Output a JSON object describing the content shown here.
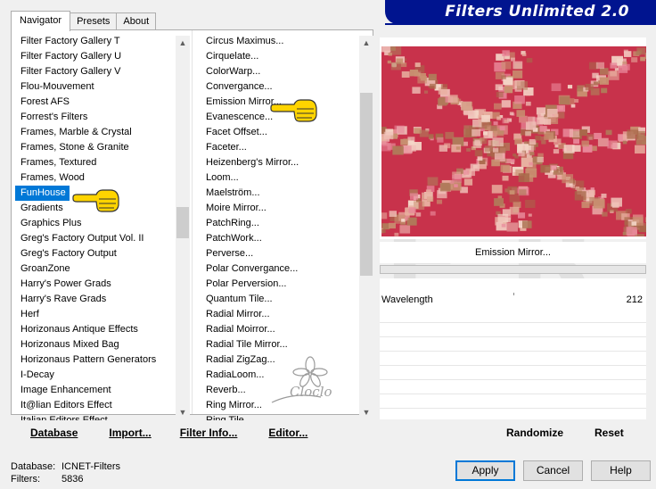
{
  "window": {
    "banner_title": "Filters Unlimited 2.0"
  },
  "tabs": [
    {
      "label": "Navigator",
      "active": true
    },
    {
      "label": "Presets",
      "active": false
    },
    {
      "label": "About",
      "active": false
    }
  ],
  "categories": {
    "items": [
      "Filter Factory Gallery T",
      "Filter Factory Gallery U",
      "Filter Factory Gallery V",
      "Flou-Mouvement",
      "Forest AFS",
      "Forrest's Filters",
      "Frames, Marble & Crystal",
      "Frames, Stone & Granite",
      "Frames, Textured",
      "Frames, Wood",
      "FunHouse",
      "Gradients",
      "Graphics Plus",
      "Greg's Factory Output Vol. II",
      "Greg's Factory Output",
      "GroanZone",
      "Harry's Power Grads",
      "Harry's Rave Grads",
      "Herf",
      "Horizonaus Antique Effects",
      "Horizonaus Mixed Bag",
      "Horizonaus Pattern Generators",
      "I-Decay",
      "Image Enhancement",
      "It@lian Editors Effect",
      "Italian Editors Effect"
    ],
    "selected": "FunHouse"
  },
  "filters": {
    "items": [
      "Circus Maximus...",
      "Cirquelate...",
      "ColorWarp...",
      "Convergance...",
      "Emission Mirror...",
      "Evanescence...",
      "Facet Offset...",
      "Faceter...",
      "Heizenberg's Mirror...",
      "Loom...",
      "Maelström...",
      "Moire Mirror...",
      "PatchRing...",
      "PatchWork...",
      "Perverse...",
      "Polar Convergance...",
      "Polar Perversion...",
      "Quantum Tile...",
      "Radial Mirror...",
      "Radial Moirror...",
      "Radial Tile Mirror...",
      "Radial ZigZag...",
      "RadiaLoom...",
      "Reverb...",
      "Ring Mirror...",
      "Ring Tile..."
    ],
    "selected": "Emission Mirror..."
  },
  "left_buttons": {
    "database": "Database",
    "import": "Import...",
    "filter_info": "Filter Info...",
    "editor": "Editor..."
  },
  "filter_display_name": "Emission Mirror...",
  "params": [
    {
      "name": "Wavelength",
      "value": "212"
    }
  ],
  "right_buttons": {
    "randomize": "Randomize",
    "reset": "Reset"
  },
  "status": {
    "database_label": "Database:",
    "database_value": "ICNET-Filters",
    "filters_label": "Filters:",
    "filters_value": "5836"
  },
  "dialog_buttons": {
    "apply": "Apply",
    "cancel": "Cancel",
    "help": "Help"
  },
  "watermark": "Cloclo",
  "colors": {
    "banner": "#00148f",
    "selection": "#0078d7",
    "preview_bg": "#c8324b"
  }
}
